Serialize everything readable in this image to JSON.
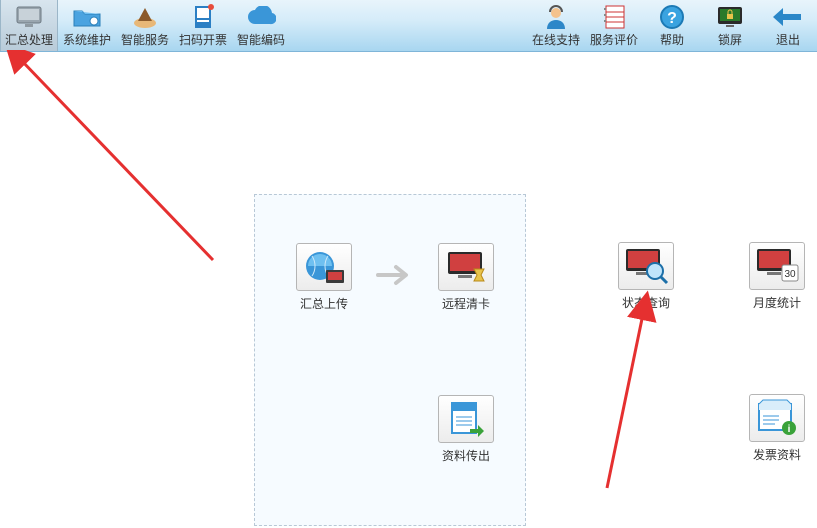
{
  "toolbar": {
    "left": [
      {
        "id": "summary",
        "label": "汇总处理"
      },
      {
        "id": "sysmaint",
        "label": "系统维护"
      },
      {
        "id": "smartservice",
        "label": "智能服务"
      },
      {
        "id": "scaninvoice",
        "label": "扫码开票"
      },
      {
        "id": "smartcode",
        "label": "智能编码"
      }
    ],
    "right": [
      {
        "id": "onlinesupport",
        "label": "在线支持"
      },
      {
        "id": "servicereview",
        "label": "服务评价"
      },
      {
        "id": "help",
        "label": "帮助"
      },
      {
        "id": "lock",
        "label": "锁屏"
      },
      {
        "id": "exit",
        "label": "退出"
      }
    ]
  },
  "panel": {
    "upload": {
      "label": "汇总上传"
    },
    "remoteclear": {
      "label": "远程清卡"
    },
    "dataexport": {
      "label": "资料传出"
    }
  },
  "side": {
    "statusquery": {
      "label": "状态查询"
    },
    "monthlystats": {
      "label": "月度统计",
      "badge": "30"
    },
    "invoicedata": {
      "label": "发票资料"
    }
  }
}
